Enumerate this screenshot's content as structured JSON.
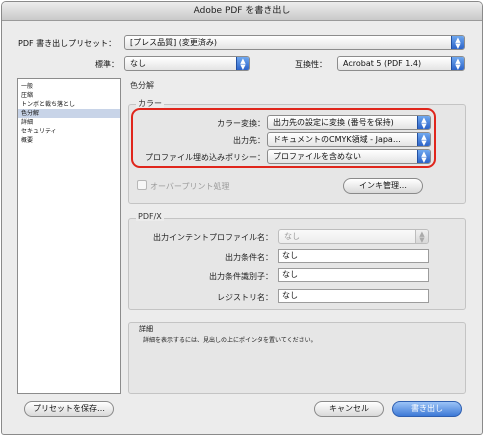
{
  "window": {
    "title": "Adobe PDF を書き出し"
  },
  "preset": {
    "label": "PDF 書き出しプリセット：",
    "value": "[プレス品質] (変更済み)"
  },
  "standard": {
    "label": "標準：",
    "value": "なし"
  },
  "compatibility": {
    "label": "互換性：",
    "value": "Acrobat 5 (PDF 1.4)"
  },
  "sidebar": {
    "items": [
      {
        "label": "一般"
      },
      {
        "label": "圧縮"
      },
      {
        "label": "トンボと裁ち落とし"
      },
      {
        "label": "色分解"
      },
      {
        "label": "詳細"
      },
      {
        "label": "セキュリティ"
      },
      {
        "label": "概要"
      }
    ],
    "selected_index": 3
  },
  "panel": {
    "title": "色分解"
  },
  "color": {
    "group_title": "カラー",
    "conversion_label": "カラー変換：",
    "conversion_value": "出力先の設定に変換 (番号を保持)",
    "destination_label": "出力先：",
    "destination_value": "ドキュメントのCMYK領域 - Japa…",
    "policy_label": "プロファイル埋め込みポリシー：",
    "policy_value": "プロファイルを含めない",
    "overprint_label": "オーバープリント処理",
    "ink_manager_label": "インキ管理…"
  },
  "pdfx": {
    "group_title": "PDF/X",
    "output_intent_label": "出力インテントプロファイル名：",
    "output_intent_value": "なし",
    "condition_name_label": "出力条件名：",
    "condition_name_value": "なし",
    "condition_id_label": "出力条件識別子：",
    "condition_id_value": "なし",
    "registry_label": "レジストリ名：",
    "registry_value": "なし"
  },
  "details": {
    "group_title": "詳細",
    "text": "詳細を表示するには、見出しの上にポインタを置いてください。"
  },
  "buttons": {
    "save_preset": "プリセットを保存…",
    "cancel": "キャンセル",
    "export": "書き出し"
  },
  "colors": {
    "highlight": "#e0261c",
    "accent": "#2c63c8"
  },
  "icons": {
    "popup_arrow": "up-down-arrows-icon"
  }
}
